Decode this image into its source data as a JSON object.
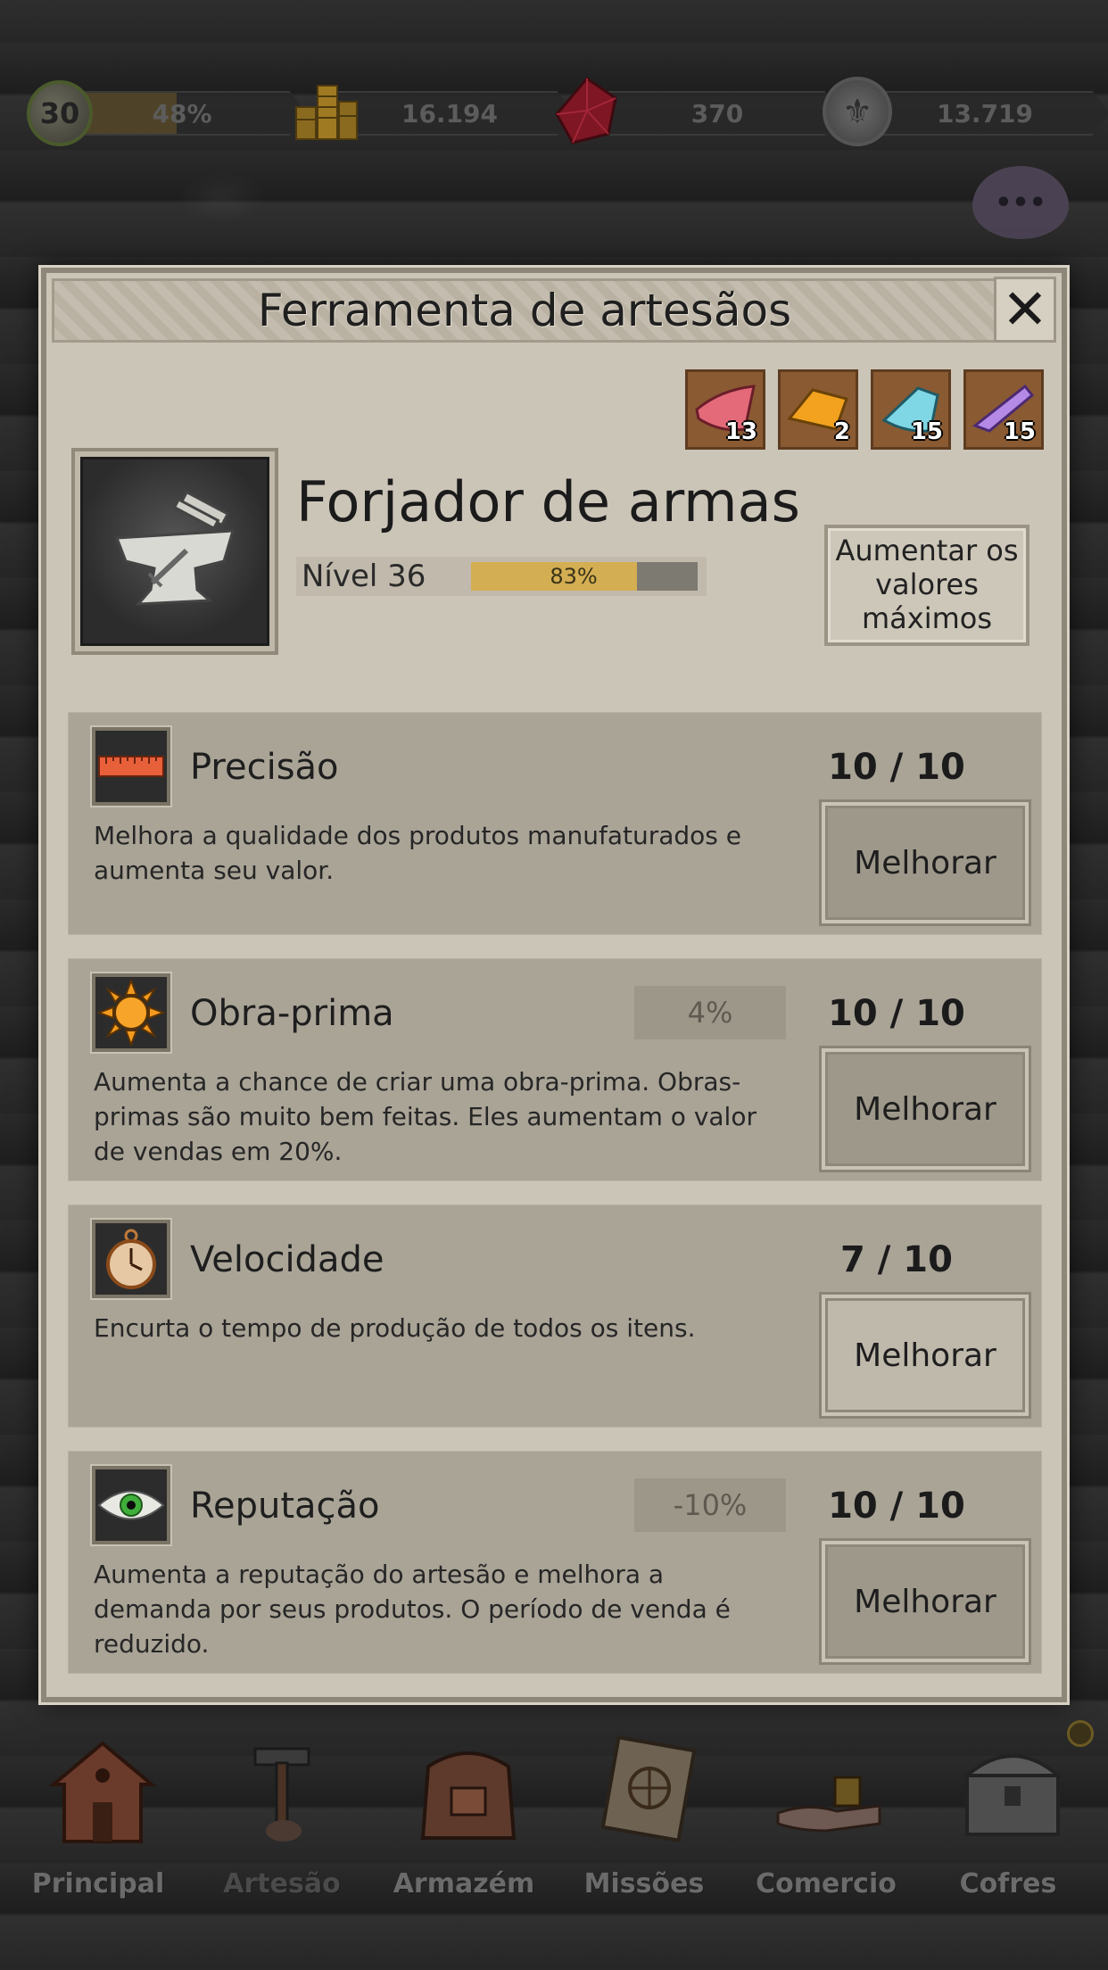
{
  "topbar": {
    "player_level": "30",
    "xp_percent": "48%",
    "xp_fraction": 0.48,
    "gold": "16.194",
    "gems": "370",
    "reputation_tokens": "13.719"
  },
  "dialog": {
    "title": "Ferramenta de artesãos",
    "close_icon": "close-icon",
    "materials": [
      {
        "icon": "red-cloth-icon",
        "color": "#e46a7a",
        "count": "13"
      },
      {
        "icon": "orange-cloth-icon",
        "color": "#f2a21e",
        "count": "2"
      },
      {
        "icon": "cyan-cloth-icon",
        "color": "#7fd6e4",
        "count": "15"
      },
      {
        "icon": "purple-cloth-icon",
        "color": "#b48ae6",
        "count": "15"
      }
    ],
    "craft": {
      "name": "Forjador de armas",
      "level_label": "Nível 36",
      "progress_text": "83%",
      "progress_fraction": 0.83
    },
    "max_button_label": "Aumentar os valores máximos",
    "upgrades": [
      {
        "name": "Precisão",
        "icon": "ruler-icon",
        "description": "Melhora a qualidade dos produtos manufaturados e aumenta seu valor.",
        "bonus": "",
        "level": "10 / 10",
        "button": "Melhorar"
      },
      {
        "name": "Obra-prima",
        "icon": "sun-icon",
        "description": "Aumenta a chance de criar uma obra-prima. Obras-primas são muito bem feitas. Eles aumentam o valor de vendas em 20%.",
        "bonus": "4%",
        "level": "10 / 10",
        "button": "Melhorar"
      },
      {
        "name": "Velocidade",
        "icon": "stopwatch-icon",
        "description": "Encurta o tempo de produção de todos os itens.",
        "bonus": "",
        "level": "7 / 10",
        "button": "Melhorar"
      },
      {
        "name": "Reputação",
        "icon": "eye-icon",
        "description": "Aumenta a reputação do artesão e melhora a demanda por seus produtos. O período de venda é reduzido.",
        "bonus": "-10%",
        "level": "10 / 10",
        "button": "Melhorar"
      }
    ]
  },
  "nav": {
    "items": [
      {
        "label": "Principal",
        "icon": "house-icon"
      },
      {
        "label": "Artesão",
        "icon": "hammer-icon",
        "active": true
      },
      {
        "label": "Armazém",
        "icon": "backpack-icon"
      },
      {
        "label": "Missões",
        "icon": "scroll-map-icon"
      },
      {
        "label": "Comercio",
        "icon": "trade-hand-icon"
      },
      {
        "label": "Cofres",
        "icon": "chest-icon"
      }
    ]
  }
}
